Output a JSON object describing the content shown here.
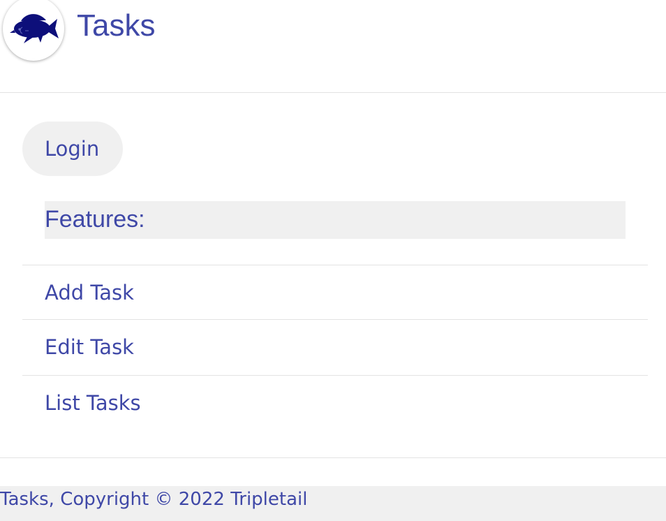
{
  "header": {
    "title": "Tasks",
    "logo_icon": "fish-logo-icon"
  },
  "nav": {
    "login_label": "Login",
    "features_heading": "Features:",
    "items": [
      {
        "label": "Add Task"
      },
      {
        "label": "Edit Task"
      },
      {
        "label": "List Tasks"
      }
    ]
  },
  "footer": {
    "text": "Tasks, Copyright © 2022 Tripletail"
  },
  "colors": {
    "text": "#3f48a7",
    "logo_fill": "#0d0f7a",
    "pill_bg": "#f0f0f0",
    "divider": "#e3e3e3"
  }
}
